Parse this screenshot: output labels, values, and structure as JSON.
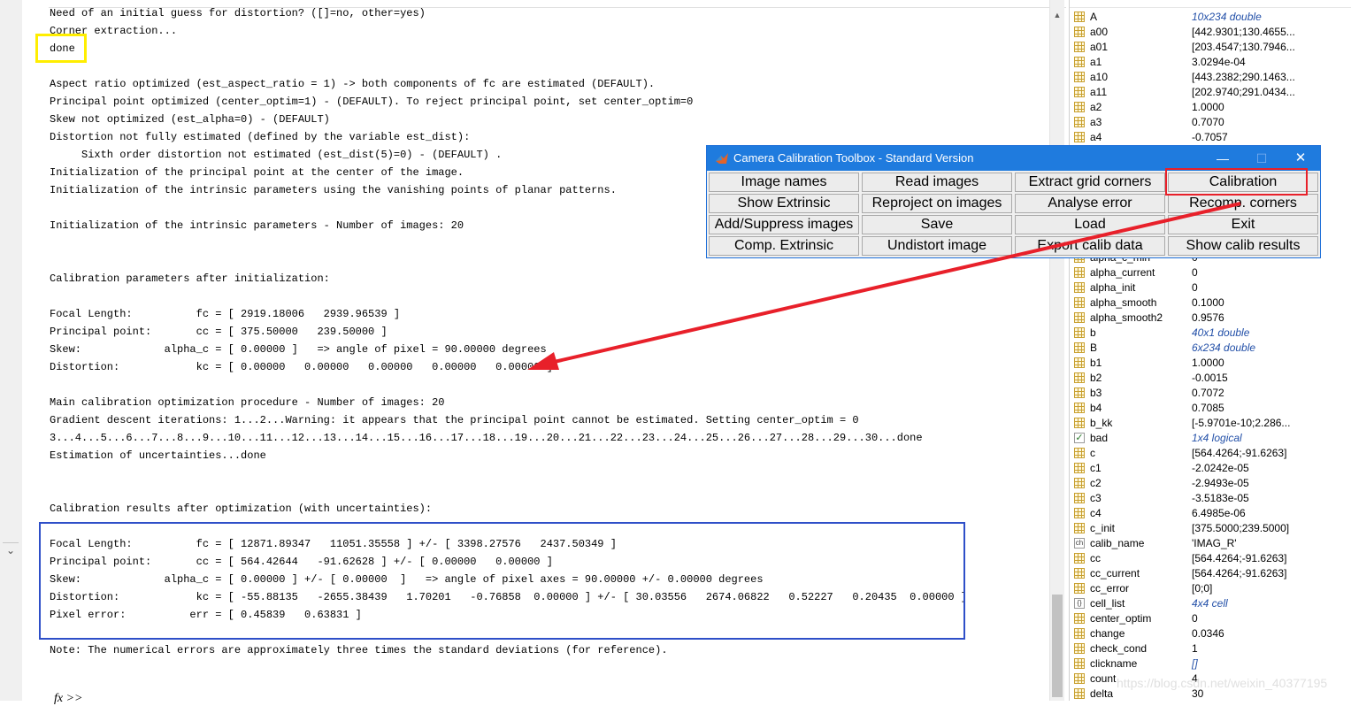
{
  "command_window": {
    "lines": [
      "Need of an initial guess for distortion? ([]=no, other=yes)",
      "Corner extraction...",
      "done",
      "",
      "Aspect ratio optimized (est_aspect_ratio = 1) -> both components of fc are estimated (DEFAULT).",
      "Principal point optimized (center_optim=1) - (DEFAULT). To reject principal point, set center_optim=0",
      "Skew not optimized (est_alpha=0) - (DEFAULT)",
      "Distortion not fully estimated (defined by the variable est_dist):",
      "     Sixth order distortion not estimated (est_dist(5)=0) - (DEFAULT) .",
      "Initialization of the principal point at the center of the image.",
      "Initialization of the intrinsic parameters using the vanishing points of planar patterns.",
      "",
      "Initialization of the intrinsic parameters - Number of images: 20",
      "",
      "",
      "Calibration parameters after initialization:",
      "",
      "Focal Length:          fc = [ 2919.18006   2939.96539 ]",
      "Principal point:       cc = [ 375.50000   239.50000 ]",
      "Skew:             alpha_c = [ 0.00000 ]   => angle of pixel = 90.00000 degrees",
      "Distortion:            kc = [ 0.00000   0.00000   0.00000   0.00000   0.00000 ]",
      "",
      "Main calibration optimization procedure - Number of images: 20",
      "Gradient descent iterations: 1...2...Warning: it appears that the principal point cannot be estimated. Setting center_optim = 0",
      "3...4...5...6...7...8...9...10...11...12...13...14...15...16...17...18...19...20...21...22...23...24...25...26...27...28...29...30...done",
      "Estimation of uncertainties...done",
      "",
      "",
      "Calibration results after optimization (with uncertainties):",
      "",
      "Focal Length:          fc = [ 12871.89347   11051.35558 ] +/- [ 3398.27576   2437.50349 ]",
      "Principal point:       cc = [ 564.42644   -91.62628 ] +/- [ 0.00000   0.00000 ]",
      "Skew:             alpha_c = [ 0.00000 ] +/- [ 0.00000  ]   => angle of pixel axes = 90.00000 +/- 0.00000 degrees",
      "Distortion:            kc = [ -55.88135   -2655.38439   1.70201   -0.76858  0.00000 ] +/- [ 30.03556   2674.06822   0.52227   0.20435  0.00000 ]",
      "Pixel error:          err = [ 0.45839   0.63831 ]",
      "",
      "Note: The numerical errors are approximately three times the standard deviations (for reference)."
    ],
    "prompt": "fx >>"
  },
  "toolbox": {
    "title": "Camera Calibration Toolbox - Standard Version",
    "minimize_glyph": "—",
    "maximize_glyph": "☐",
    "close_glyph": "✕",
    "buttons": [
      [
        "Image names",
        "Read images",
        "Extract grid corners",
        "Calibration"
      ],
      [
        "Show Extrinsic",
        "Reproject on images",
        "Analyse error",
        "Recomp. corners"
      ],
      [
        "Add/Suppress images",
        "Save",
        "Load",
        "Exit"
      ],
      [
        "Comp. Extrinsic",
        "Undistort image",
        "Export calib data",
        "Show calib results"
      ]
    ],
    "title_bar_color": "#1f7bde"
  },
  "workspace": {
    "top_rows": [
      {
        "icon": "grid",
        "name": "A",
        "value": "10x234 double",
        "link": true
      },
      {
        "icon": "grid",
        "name": "a00",
        "value": "[442.9301;130.4655...",
        "link": false
      },
      {
        "icon": "grid",
        "name": "a01",
        "value": "[203.4547;130.7946...",
        "link": false
      },
      {
        "icon": "grid",
        "name": "a1",
        "value": "3.0294e-04",
        "link": false
      },
      {
        "icon": "grid",
        "name": "a10",
        "value": "[443.2382;290.1463...",
        "link": false
      },
      {
        "icon": "grid",
        "name": "a11",
        "value": "[202.9740;291.0434...",
        "link": false
      },
      {
        "icon": "grid",
        "name": "a2",
        "value": "1.0000",
        "link": false
      },
      {
        "icon": "grid",
        "name": "a3",
        "value": "0.7070",
        "link": false
      },
      {
        "icon": "grid",
        "name": "a4",
        "value": "-0.7057",
        "link": false
      }
    ],
    "bottom_rows": [
      {
        "icon": "grid",
        "name": "alpha_c_min",
        "value": "0",
        "link": false
      },
      {
        "icon": "grid",
        "name": "alpha_current",
        "value": "0",
        "link": false
      },
      {
        "icon": "grid",
        "name": "alpha_init",
        "value": "0",
        "link": false
      },
      {
        "icon": "grid",
        "name": "alpha_smooth",
        "value": "0.1000",
        "link": false
      },
      {
        "icon": "grid",
        "name": "alpha_smooth2",
        "value": "0.9576",
        "link": false
      },
      {
        "icon": "grid",
        "name": "b",
        "value": "40x1 double",
        "link": true
      },
      {
        "icon": "grid",
        "name": "B",
        "value": "6x234 double",
        "link": true
      },
      {
        "icon": "grid",
        "name": "b1",
        "value": "1.0000",
        "link": false
      },
      {
        "icon": "grid",
        "name": "b2",
        "value": "-0.0015",
        "link": false
      },
      {
        "icon": "grid",
        "name": "b3",
        "value": "0.7072",
        "link": false
      },
      {
        "icon": "grid",
        "name": "b4",
        "value": "0.7085",
        "link": false
      },
      {
        "icon": "grid",
        "name": "b_kk",
        "value": "[-5.9701e-10;2.286...",
        "link": false
      },
      {
        "icon": "check",
        "name": "bad",
        "value": "1x4 logical",
        "link": true
      },
      {
        "icon": "grid",
        "name": "c",
        "value": "[564.4264;-91.6263]",
        "link": false
      },
      {
        "icon": "grid",
        "name": "c1",
        "value": "-2.0242e-05",
        "link": false
      },
      {
        "icon": "grid",
        "name": "c2",
        "value": "-2.9493e-05",
        "link": false
      },
      {
        "icon": "grid",
        "name": "c3",
        "value": "-3.5183e-05",
        "link": false
      },
      {
        "icon": "grid",
        "name": "c4",
        "value": "6.4985e-06",
        "link": false
      },
      {
        "icon": "grid",
        "name": "c_init",
        "value": "[375.5000;239.5000]",
        "link": false
      },
      {
        "icon": "char",
        "name": "calib_name",
        "value": "'IMAG_R'",
        "link": false
      },
      {
        "icon": "grid",
        "name": "cc",
        "value": "[564.4264;-91.6263]",
        "link": false
      },
      {
        "icon": "grid",
        "name": "cc_current",
        "value": "[564.4264;-91.6263]",
        "link": false
      },
      {
        "icon": "grid",
        "name": "cc_error",
        "value": "[0;0]",
        "link": false
      },
      {
        "icon": "cell",
        "name": "cell_list",
        "value": "4x4 cell",
        "link": true
      },
      {
        "icon": "grid",
        "name": "center_optim",
        "value": "0",
        "link": false
      },
      {
        "icon": "grid",
        "name": "change",
        "value": "0.0346",
        "link": false
      },
      {
        "icon": "grid",
        "name": "check_cond",
        "value": "1",
        "link": false
      },
      {
        "icon": "grid",
        "name": "clickname",
        "value": "[]",
        "link": true
      },
      {
        "icon": "grid",
        "name": "count",
        "value": "4",
        "link": false
      },
      {
        "icon": "grid",
        "name": "delta",
        "value": "30",
        "link": false
      }
    ],
    "watermark": "https://blog.csdn.net/weixin_40377195"
  },
  "annotation_colors": {
    "highlight_yellow": "#ffee00",
    "results_box_blue": "#2e4fc8",
    "button_box_red": "#e8202a",
    "arrow_red": "#e8202a"
  }
}
